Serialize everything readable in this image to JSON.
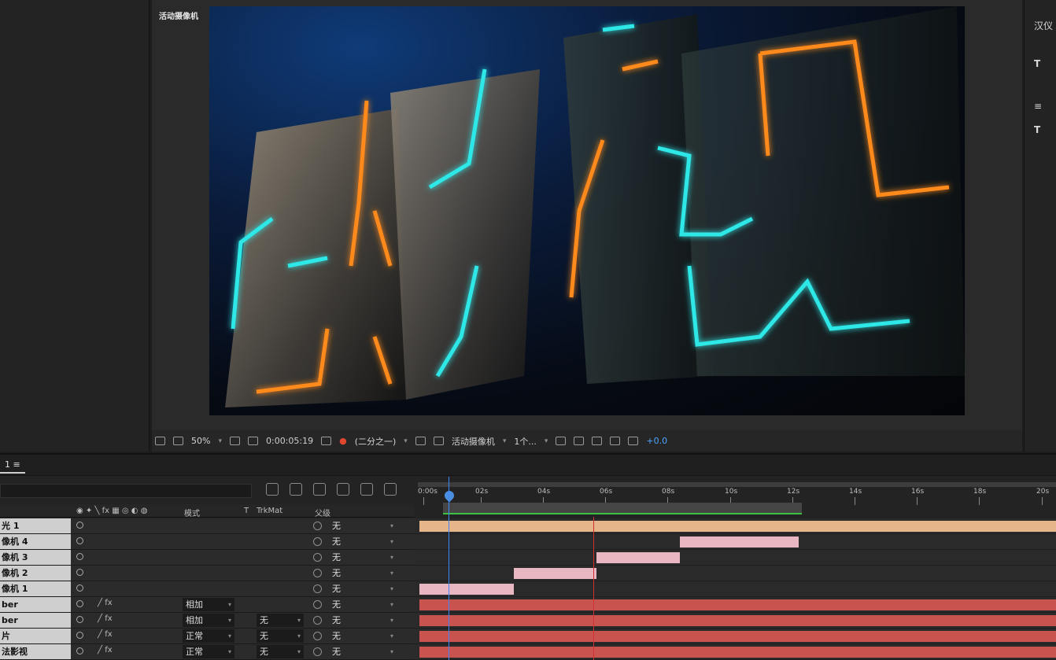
{
  "viewer": {
    "active_camera_label": "活动摄像机"
  },
  "viewer_toolbar": {
    "zoom": "50%",
    "timecode": "0:00:05:19",
    "resolution": "(二分之一)",
    "camera": "活动摄像机",
    "views": "1个...",
    "exposure": "+0.0"
  },
  "right_panel": {
    "items": [
      "汉仪",
      "T",
      "T"
    ]
  },
  "timeline": {
    "tab_label": "1 ≡",
    "columns": {
      "mode": "模式",
      "t": "T",
      "trkmat": "TrkMat",
      "parent": "父级"
    },
    "ticks": [
      "0:00s",
      "02s",
      "04s",
      "06s",
      "08s",
      "10s",
      "12s",
      "14s",
      "16s",
      "18s",
      "20s"
    ],
    "layers": [
      {
        "name": "光 1",
        "mode": "",
        "trkmat": "",
        "parent": "无",
        "color": "#e6b58a"
      },
      {
        "name": "像机 4",
        "mode": "",
        "trkmat": "",
        "parent": "无",
        "color": "#e9b7c2"
      },
      {
        "name": "像机 3",
        "mode": "",
        "trkmat": "",
        "parent": "无",
        "color": "#e9b7c2"
      },
      {
        "name": "像机 2",
        "mode": "",
        "trkmat": "",
        "parent": "无",
        "color": "#e9b7c2"
      },
      {
        "name": "像机 1",
        "mode": "",
        "trkmat": "",
        "parent": "无",
        "color": "#e9b7c2"
      },
      {
        "name": "ber",
        "mode": "相加",
        "trkmat": "",
        "parent": "无",
        "color": "#c9534f"
      },
      {
        "name": "ber",
        "mode": "相加",
        "trkmat": "无",
        "parent": "无",
        "color": "#c9534f"
      },
      {
        "name": "片",
        "mode": "正常",
        "trkmat": "无",
        "parent": "无",
        "color": "#c9534f"
      },
      {
        "name": "法影视",
        "mode": "正常",
        "trkmat": "无",
        "parent": "无",
        "color": "#c9534f"
      }
    ]
  }
}
